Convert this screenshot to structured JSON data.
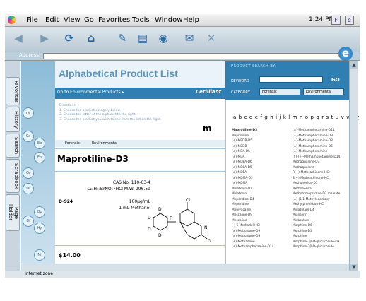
{
  "menubar": {
    "items": [
      "File",
      "Edit",
      "View",
      "Go",
      "Favorites",
      "Tools",
      "Window",
      "Help"
    ],
    "time": "1:24 PM",
    "box1": "F",
    "box2": "e"
  },
  "toolbar": {
    "icons": [
      "back-icon",
      "forward-icon",
      "refresh-icon",
      "home-icon",
      "favorites-icon",
      "print-icon",
      "history-icon",
      "mail-icon",
      "stop-icon"
    ]
  },
  "address": {
    "label": "Address:",
    "value": ""
  },
  "sidebar": {
    "tabs": [
      "Favorites",
      "History",
      "Search",
      "Scrapbook",
      "Page Holder"
    ]
  },
  "page": {
    "title": "Alphabetical Product List",
    "nav_link": "Go to Environmental Products ▸",
    "brand": "Cerilliant",
    "search_header": "PRODUCT SEARCH BY:",
    "keyword_label": "KEYWORD",
    "go_label": "GO",
    "category_label": "CATEGORY",
    "cat1": "Forensic",
    "cat2": "Environmental",
    "directions": [
      "Directions:",
      "1. Choose the product category below.",
      "2. Choose the letter of the alphabet to the right.",
      "3. Choose the product you wish to see from the list on the right."
    ],
    "big_letter": "m",
    "tab1": "Forensic",
    "tab2": "Environmental",
    "product_name": "Maprotiline-D3",
    "cas": "CAS No. 110-63-4",
    "formula": "C₂₀H₁₉BrNO₂•HCl M.W. 296.59",
    "code": "D-924",
    "conc": "100μg/mL",
    "volume": "1 mL Methanol",
    "price": "$14.00",
    "alphabet": "a b c d e f g h i j k l m n o p q r s t u v w x y z",
    "hex_labels": [
      "ne",
      "Ca",
      "Ep",
      "En",
      "Gr",
      "Oi",
      "Op",
      "Hy",
      "Di",
      "Ni"
    ],
    "col1": [
      "Maprotiline-D3",
      "Maprotiline",
      "(±)-MBDB-D5",
      "(±)-MBDB",
      "(±)-MDA-D5",
      "(±)-MDA",
      "(±)-MDEA-D6",
      "(±)-MDEA-D5",
      "(±)-MDEA",
      "(±)-MDMA-D5",
      "(±)-MDMA",
      "Melatonin-D7",
      "Melatonin",
      "Meperidine-D4",
      "Meperidine",
      "Mepivacaine",
      "Mescaline-D9",
      "Mescaline",
      "(-)-6-Methadol-HCl",
      "(±)-Methadone-D9",
      "(±)-Methadone-D3",
      "(±)-Methadone",
      "(±)-Methamphetamine-D14"
    ],
    "col2": [
      "(±)-Methamphetamine-D11",
      "(±)-Methamphetamine-D9",
      "(±)-Methamphetamine-D8",
      "(±)-Methamphetamine-D5",
      "(±)-Methamphetamine",
      "(S)-(+)-Methamphetamine-D14",
      "Methaqualone-D7",
      "Methaqualone",
      "R(+)-Methcathinone-HCl",
      "S(+)-Methcathinone-HCl",
      "Methohexital-D5",
      "Methohexital",
      "Methotrimeprazine-D3 maleate",
      "(±)-(1,1-Methylenedioxy",
      "Methylphenidate-HCl",
      "Midazolam-D4",
      "Mianserin",
      "Midazolam",
      "Morphine-D6",
      "Morphine-D3",
      "Morphine",
      "Morphine-3β-D-glucuronide-D3",
      "Morphine-3β-D-glucuronide"
    ]
  },
  "status": {
    "zone": "Internet zone"
  }
}
